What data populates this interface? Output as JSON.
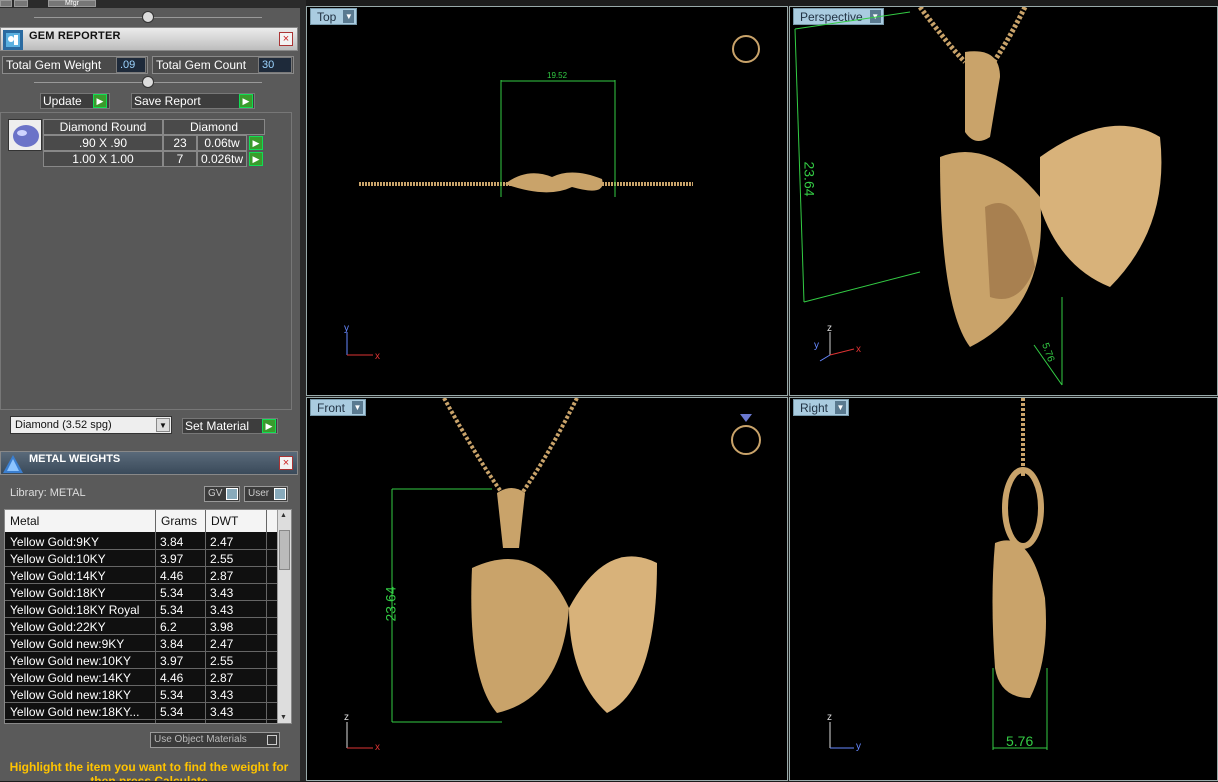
{
  "top_strip": {
    "menu_label": "Mfgr"
  },
  "gem_reporter": {
    "title": "GEM REPORTER",
    "close_label": "×",
    "total_weight_label": "Total Gem Weight",
    "total_weight_value": ".09",
    "total_count_label": "Total Gem Count",
    "total_count_value": "30",
    "update_label": "Update",
    "save_report_label": "Save Report",
    "header": {
      "col1": "Diamond Round",
      "col2": "Diamond"
    },
    "rows": [
      {
        "size": ".90 X .90",
        "count": "23",
        "weight": "0.06tw"
      },
      {
        "size": "1.00 X 1.00",
        "count": "7",
        "weight": "0.026tw"
      }
    ],
    "material_select": "Diamond    (3.52 spg)",
    "set_material_label": "Set Material"
  },
  "metal_weights": {
    "title": "METAL WEIGHTS",
    "close_label": "×",
    "library_label": "Library: METAL",
    "gv_label": "GV",
    "user_label": "User",
    "columns": [
      "Metal",
      "Grams",
      "DWT"
    ],
    "rows": [
      {
        "metal": "Yellow Gold:9KY",
        "grams": "3.84",
        "dwt": "2.47"
      },
      {
        "metal": "Yellow Gold:10KY",
        "grams": "3.97",
        "dwt": "2.55"
      },
      {
        "metal": "Yellow Gold:14KY",
        "grams": "4.46",
        "dwt": "2.87"
      },
      {
        "metal": "Yellow Gold:18KY",
        "grams": "5.34",
        "dwt": "3.43"
      },
      {
        "metal": "Yellow Gold:18KY Royal",
        "grams": "5.34",
        "dwt": "3.43"
      },
      {
        "metal": "Yellow Gold:22KY",
        "grams": "6.2",
        "dwt": "3.98"
      },
      {
        "metal": "Yellow Gold new:9KY",
        "grams": "3.84",
        "dwt": "2.47"
      },
      {
        "metal": "Yellow Gold new:10KY",
        "grams": "3.97",
        "dwt": "2.55"
      },
      {
        "metal": "Yellow Gold new:14KY",
        "grams": "4.46",
        "dwt": "2.87"
      },
      {
        "metal": "Yellow Gold new:18KY",
        "grams": "5.34",
        "dwt": "3.43"
      },
      {
        "metal": "Yellow Gold new:18KY...",
        "grams": "5.34",
        "dwt": "3.43"
      }
    ],
    "use_object_label": "Use Object Materials",
    "hint": "Highlight the item you want to find the weight for then press Calculate"
  },
  "viewports": {
    "top": {
      "label": "Top",
      "dim": "19.52"
    },
    "perspective": {
      "label": "Perspective",
      "dim_h": "23.64",
      "dim_w": "5.76"
    },
    "front": {
      "label": "Front",
      "dim": "23.64"
    },
    "right": {
      "label": "Right",
      "dim": "5.76"
    }
  },
  "colors": {
    "gold": "#c9a36a",
    "dimension": "#33cc44",
    "hint": "#ffc400",
    "tab": "#aacce0"
  }
}
